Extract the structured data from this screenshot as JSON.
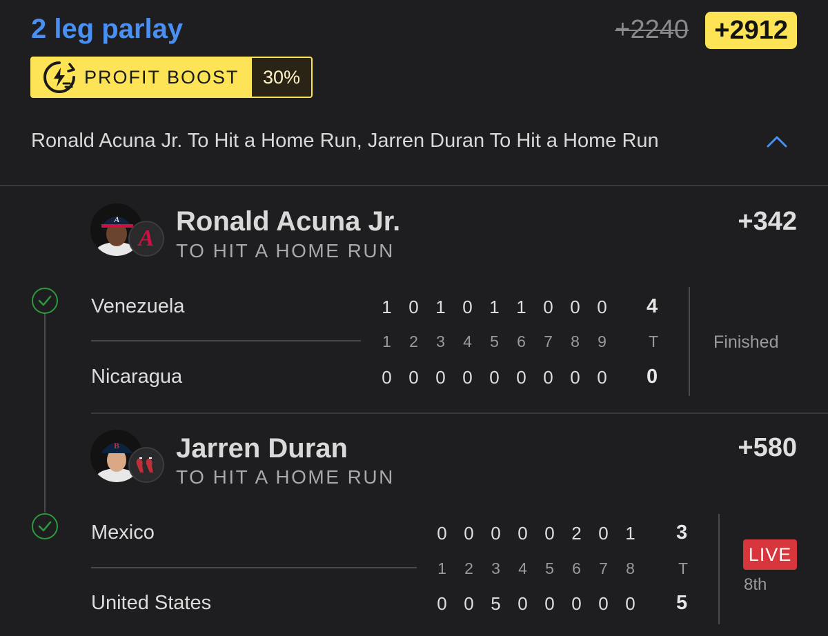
{
  "header": {
    "title": "2 leg parlay",
    "odds_original": "+2240",
    "odds_boosted": "+2912",
    "boost_label": "PROFIT BOOST",
    "boost_percent": "30%",
    "summary": "Ronald Acuna Jr. To Hit a Home Run, Jarren Duran To Hit a Home Run"
  },
  "legs": [
    {
      "player": "Ronald Acuna Jr.",
      "market": "TO HIT A HOME RUN",
      "odds": "+342",
      "team_logo": "A",
      "game": {
        "away": {
          "name": "Venezuela",
          "innings": [
            "1",
            "0",
            "1",
            "0",
            "1",
            "1",
            "0",
            "0",
            "0"
          ],
          "total": "4"
        },
        "home": {
          "name": "Nicaragua",
          "innings": [
            "0",
            "0",
            "0",
            "0",
            "0",
            "0",
            "0",
            "0",
            "0"
          ],
          "total": "0"
        },
        "inning_headers": [
          "1",
          "2",
          "3",
          "4",
          "5",
          "6",
          "7",
          "8",
          "9"
        ],
        "total_header": "T",
        "status": "Finished"
      }
    },
    {
      "player": "Jarren Duran",
      "market": "TO HIT A HOME RUN",
      "odds": "+580",
      "team_logo": "B",
      "game": {
        "away": {
          "name": "Mexico",
          "innings": [
            "0",
            "0",
            "0",
            "0",
            "0",
            "2",
            "0",
            "1"
          ],
          "total": "3"
        },
        "home": {
          "name": "United States",
          "innings": [
            "0",
            "0",
            "5",
            "0",
            "0",
            "0",
            "0",
            "0"
          ],
          "total": "5"
        },
        "inning_headers": [
          "1",
          "2",
          "3",
          "4",
          "5",
          "6",
          "7",
          "8"
        ],
        "total_header": "T",
        "status": "LIVE",
        "current_inning": "8th"
      }
    }
  ],
  "colors": {
    "background": "#1e1e20",
    "title_blue": "#4a8ff2",
    "boost_yellow": "#fde456",
    "check_green": "#2e9a3e",
    "live_red": "#d8363d"
  }
}
